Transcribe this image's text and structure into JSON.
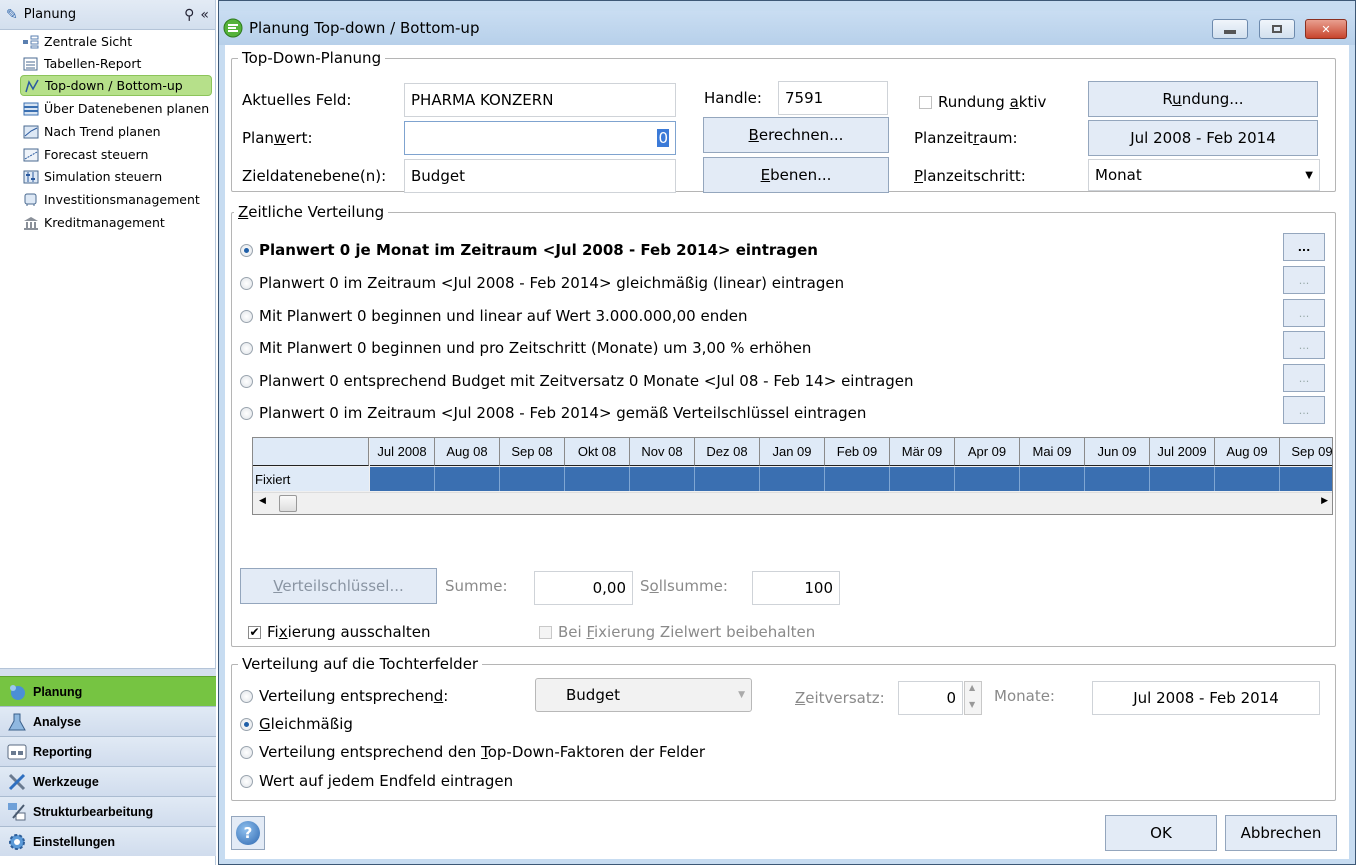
{
  "sidebar": {
    "header": "Planung",
    "items": [
      {
        "label": "Zentrale Sicht",
        "icon": "hierarchy-icon"
      },
      {
        "label": "Tabellen-Report",
        "icon": "table-report-icon"
      },
      {
        "label": "Top-down / Bottom-up",
        "icon": "top-down-icon",
        "active": true
      },
      {
        "label": "Über Datenebenen planen",
        "icon": "data-levels-icon"
      },
      {
        "label": "Nach Trend planen",
        "icon": "trend-icon"
      },
      {
        "label": "Forecast steuern",
        "icon": "forecast-icon"
      },
      {
        "label": "Simulation steuern",
        "icon": "simulation-icon"
      },
      {
        "label": "Investitionsmanagement",
        "icon": "investment-icon"
      },
      {
        "label": "Kreditmanagement",
        "icon": "bank-icon"
      }
    ],
    "nav": [
      {
        "label": "Planung",
        "active": true
      },
      {
        "label": "Analyse"
      },
      {
        "label": "Reporting"
      },
      {
        "label": "Werkzeuge"
      },
      {
        "label": "Strukturbearbeitung"
      },
      {
        "label": "Einstellungen"
      }
    ]
  },
  "dialog": {
    "title": "Planung Top-down / Bottom-up",
    "topdown": {
      "legend": "Top-Down-Planung",
      "aktuelles_feld_label": "Aktuelles Feld:",
      "aktuelles_feld_value": "PHARMA KONZERN",
      "planwert_label": "Planwert:",
      "planwert_value": "0",
      "zieldatenebene_label": "Zieldatenebene(n):",
      "zieldatenebene_value": "Budget",
      "handle_label": "Handle:",
      "handle_value": "7591",
      "berechnen_button": "Berechnen...",
      "ebenen_button": "Ebenen...",
      "rundung_aktiv_label": "Rundung aktiv",
      "rundung_aktiv_checked": false,
      "rundung_button": "Rundung...",
      "planzeitraum_label": "Planzeitraum:",
      "planzeitraum_value": "Jul 2008 - Feb 2014",
      "planzeitschritt_label": "Planzeitschritt:",
      "planzeitschritt_value": "Monat"
    },
    "zeitliche": {
      "legend": "Zeitliche Verteilung",
      "options": [
        {
          "label": "Planwert 0 je Monat im Zeitraum <Jul 2008 - Feb 2014> eintragen",
          "selected": true
        },
        {
          "label": "Planwert 0 im Zeitraum <Jul 2008 - Feb 2014> gleichmäßig (linear) eintragen"
        },
        {
          "label": "Mit Planwert 0 beginnen und linear auf Wert 3.000.000,00 enden"
        },
        {
          "label": "Mit Planwert 0 beginnen und pro Zeitschritt (Monate) um 3,00 % erhöhen"
        },
        {
          "label": "Planwert 0 entsprechend Budget mit Zeitversatz 0 Monate <Jul 08 - Feb 14> eintragen"
        },
        {
          "label": "Planwert 0 im Zeitraum <Jul 2008 - Feb 2014> gemäß Verteilschlüssel eintragen"
        }
      ],
      "dots_label": "...",
      "grid_columns": [
        "Jul 2008",
        "Aug 08",
        "Sep 08",
        "Okt 08",
        "Nov 08",
        "Dez 08",
        "Jan 09",
        "Feb 09",
        "Mär 09",
        "Apr 09",
        "Mai 09",
        "Jun 09",
        "Jul 2009",
        "Aug 09",
        "Sep 09"
      ],
      "grid_row_label": "Fixiert",
      "verteilschluessel_button": "Verteilschlüssel...",
      "summe_label": "Summe:",
      "summe_value": "0,00",
      "sollsumme_label": "Sollsumme:",
      "sollsumme_value": "100",
      "fixierung_ausschalten_label": "Fixierung ausschalten",
      "fixierung_ausschalten_checked": true,
      "zielwert_beibehalten_label": "Bei Fixierung Zielwert beibehalten",
      "zielwert_beibehalten_checked": false
    },
    "tochter": {
      "legend": "Verteilung auf die Tochterfelder",
      "options": [
        {
          "label": "Verteilung entsprechend:"
        },
        {
          "label": "Gleichmäßig",
          "selected": true
        },
        {
          "label": "Verteilung entsprechend den Top-Down-Faktoren der Felder"
        },
        {
          "label": "Wert auf jedem Endfeld eintragen"
        }
      ],
      "dropdown_value": "Budget",
      "zeitversatz_label": "Zeitversatz:",
      "zeitversatz_value": "0",
      "monate_label": "Monate:",
      "monate_range": "Jul 2008 - Feb 2014"
    },
    "ok_button": "OK",
    "cancel_button": "Abbrechen"
  }
}
